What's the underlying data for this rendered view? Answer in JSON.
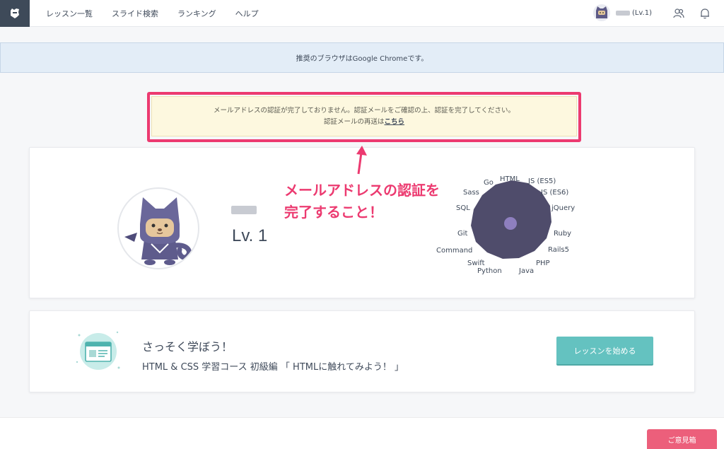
{
  "header": {
    "nav": [
      {
        "label": "レッスン一覧"
      },
      {
        "label": "スライド検索"
      },
      {
        "label": "ランキング"
      },
      {
        "label": "ヘルプ"
      }
    ],
    "user_level": "(Lv.1)"
  },
  "browser_notice": "推奨のブラウザはGoogle Chromeです。",
  "email_warning": {
    "line1": "メールアドレスの認証が完了しておりません。認証メールをご確認の上、認証を完了してください。",
    "line2_prefix": "認証メールの再送は",
    "link": "こちら"
  },
  "annotation": {
    "line1": "メールアドレスの認証を",
    "line2": "完了すること！"
  },
  "profile": {
    "level": "Lv. 1",
    "skills": [
      "HTML",
      "JS (ES5)",
      "JS (ES6)",
      "jQuery",
      "Ruby",
      "Rails5",
      "PHP",
      "Java",
      "Python",
      "Swift",
      "Command",
      "Git",
      "SQL",
      "Sass",
      "Go"
    ]
  },
  "lesson": {
    "heading": "さっそく学ぼう！",
    "title": "HTML & CSS 学習コース 初級編 「 HTMLに触れてみよう！ 」",
    "start_button": "レッスンを始める"
  },
  "feedback_button": "ご意見箱",
  "colors": {
    "accent_pink": "#ec3a70",
    "teal": "#64c2c0",
    "navy": "#3e4a59",
    "radar_fill": "#4f4c6b",
    "radar_center": "#8e7fbf"
  }
}
